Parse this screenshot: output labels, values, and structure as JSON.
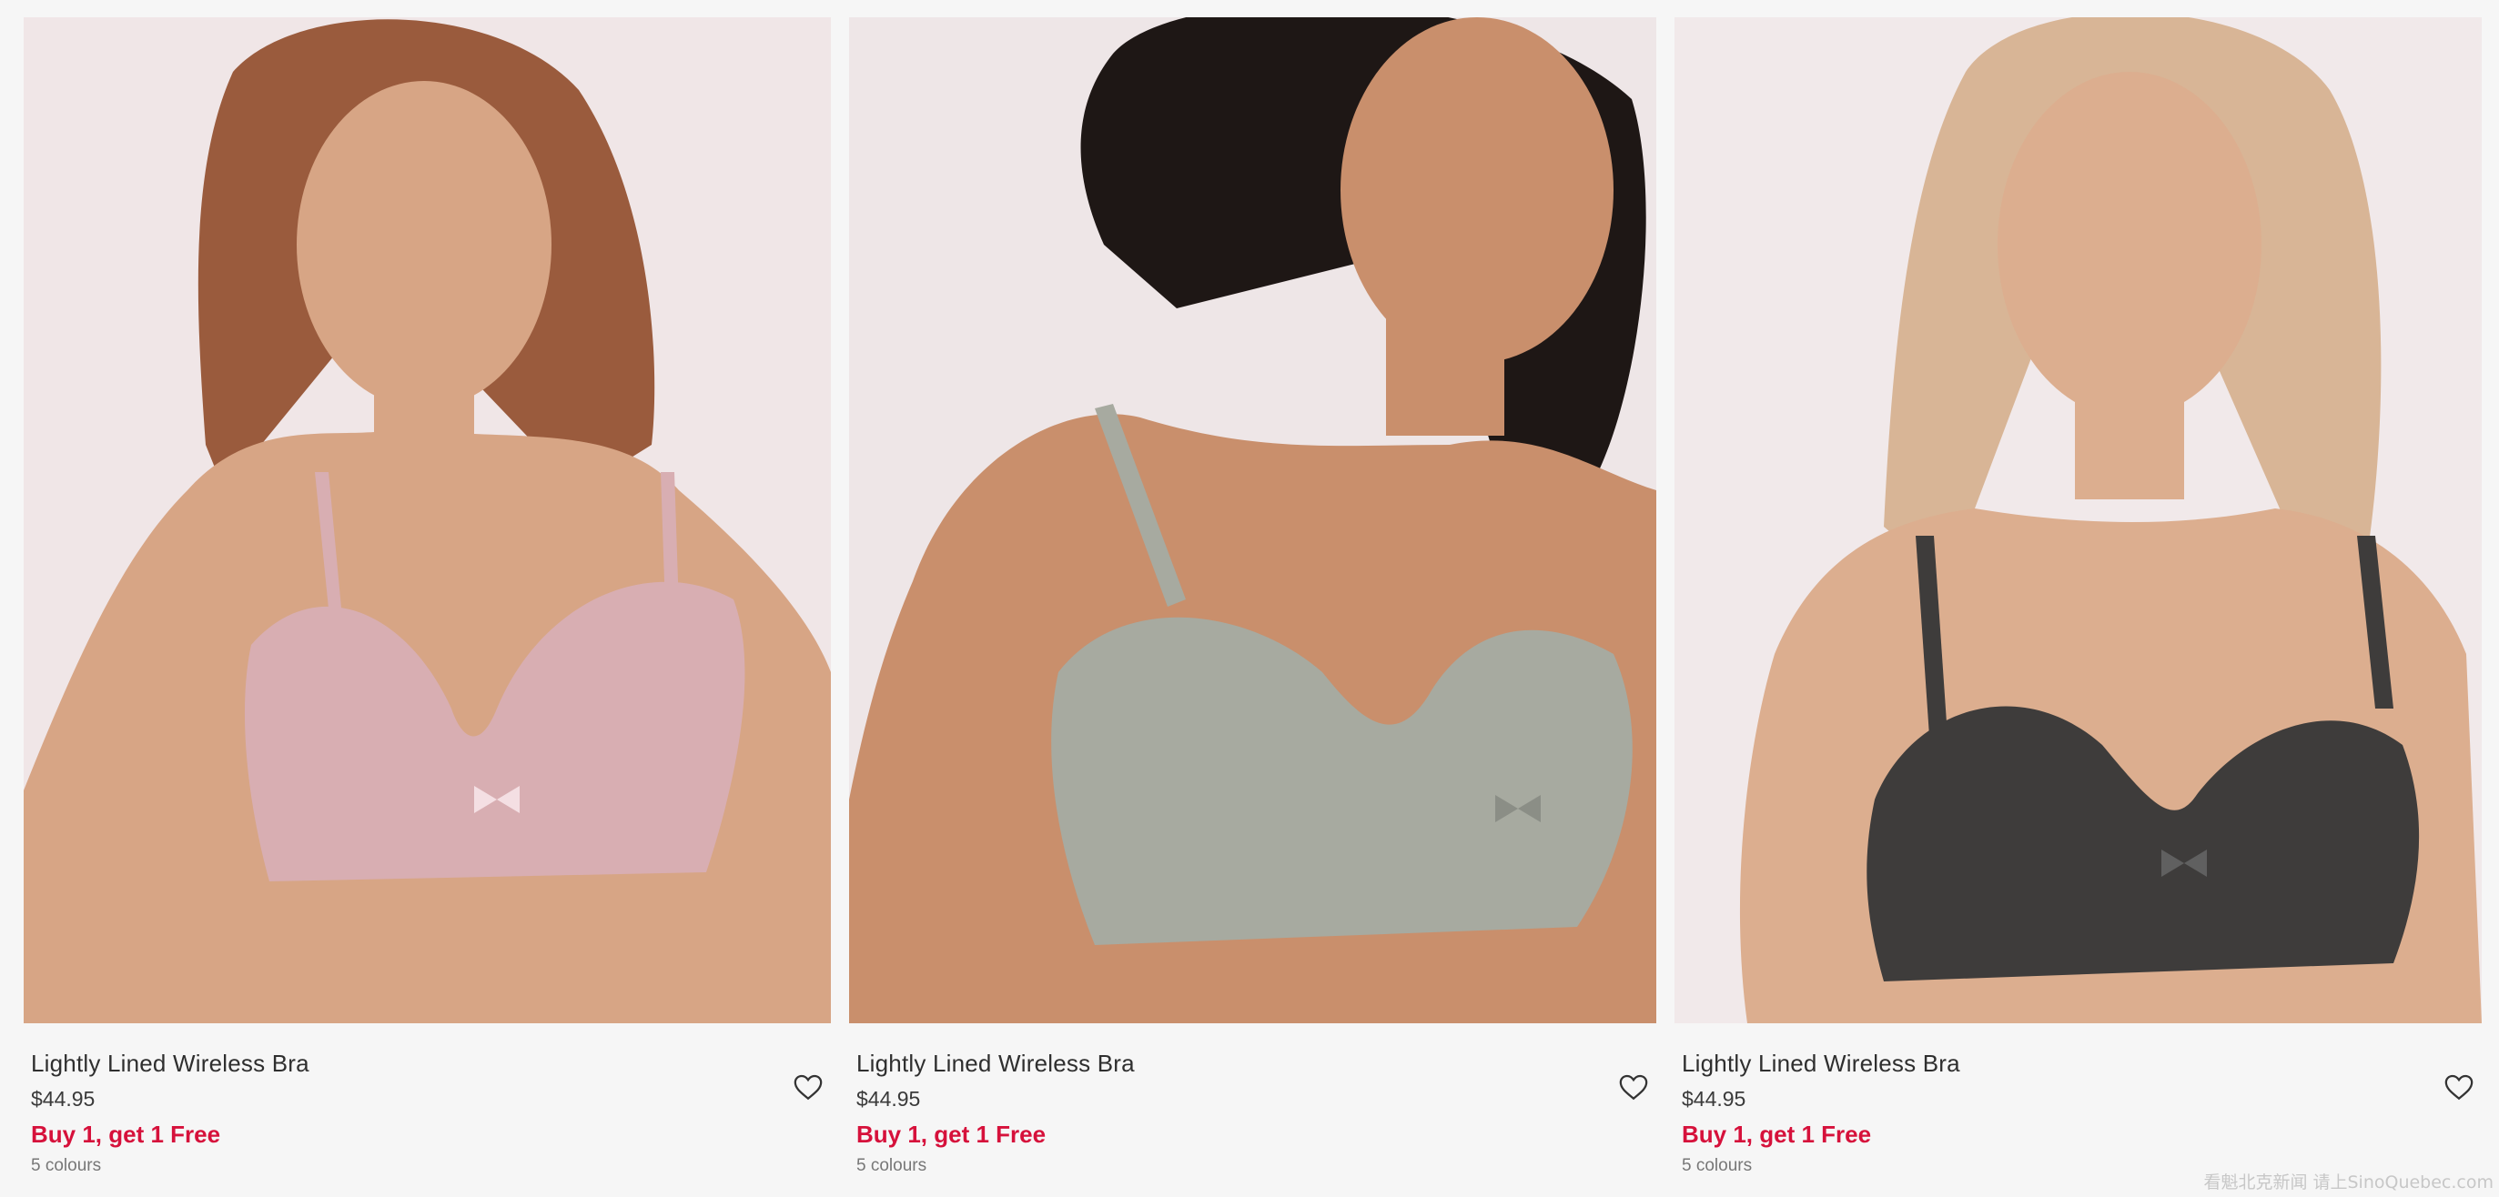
{
  "products": [
    {
      "name": "Lightly Lined Wireless Bra",
      "price": "$44.95",
      "promo": "Buy 1, get 1 Free",
      "colours": "5 colours",
      "swatch": "#d8aeb2",
      "skin": "#d7a585",
      "hair": "#9a5b3d",
      "favorite_icon": "heart-outline-icon"
    },
    {
      "name": "Lightly Lined Wireless Bra",
      "price": "$44.95",
      "promo": "Buy 1, get 1 Free",
      "colours": "5 colours",
      "swatch": "#a7aaa0",
      "skin": "#c98f6c",
      "hair": "#1e1715",
      "favorite_icon": "heart-outline-icon"
    },
    {
      "name": "Lightly Lined Wireless Bra",
      "price": "$44.95",
      "promo": "Buy 1, get 1 Free",
      "colours": "5 colours",
      "swatch": "#3e3c3b",
      "skin": "#dcae8f",
      "hair": "#d8b596",
      "favorite_icon": "heart-outline-icon"
    }
  ],
  "watermark": "看魁北克新闻 请上SinoQuebec.com",
  "colors": {
    "promo": "#d6113b",
    "background": "#f6f6f6"
  }
}
